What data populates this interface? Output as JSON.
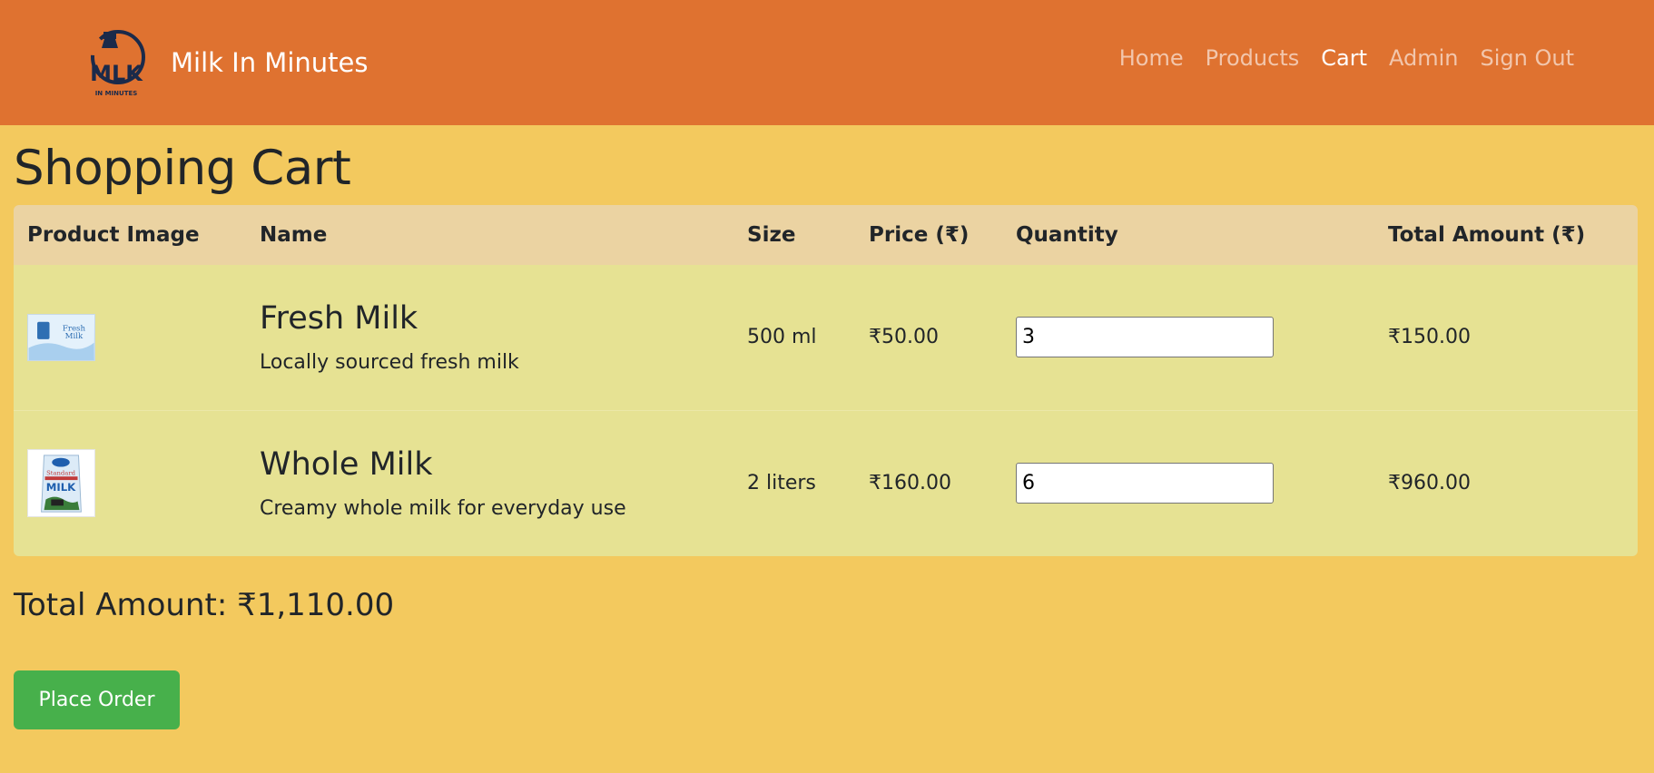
{
  "brand": {
    "name": "Milk In Minutes",
    "logo_text": "MILK",
    "logo_sub": "IN MINUTES"
  },
  "nav": {
    "items": [
      {
        "label": "Home",
        "active": false
      },
      {
        "label": "Products",
        "active": false
      },
      {
        "label": "Cart",
        "active": true
      },
      {
        "label": "Admin",
        "active": false
      },
      {
        "label": "Sign Out",
        "active": false
      }
    ]
  },
  "page_title": "Shopping Cart",
  "table": {
    "headers": [
      "Product Image",
      "Name",
      "Size",
      "Price (₹)",
      "Quantity",
      "Total Amount (₹)"
    ],
    "rows": [
      {
        "image_icon": "fresh-milk-image",
        "name": "Fresh Milk",
        "description": "Locally sourced fresh milk",
        "size": "500 ml",
        "price": "₹50.00",
        "quantity": "3",
        "total": "₹150.00"
      },
      {
        "image_icon": "whole-milk-image",
        "name": "Whole Milk",
        "description": "Creamy whole milk for everyday use",
        "size": "2 liters",
        "price": "₹160.00",
        "quantity": "6",
        "total": "₹960.00"
      }
    ]
  },
  "total_amount": "Total Amount: ₹1,110.00",
  "place_order_label": "Place Order",
  "colors": {
    "navbar": "#df7230",
    "background": "#f3c95e",
    "table_header": "#ebd3a2",
    "table_row": "#e6e293",
    "button": "#47b04b"
  }
}
